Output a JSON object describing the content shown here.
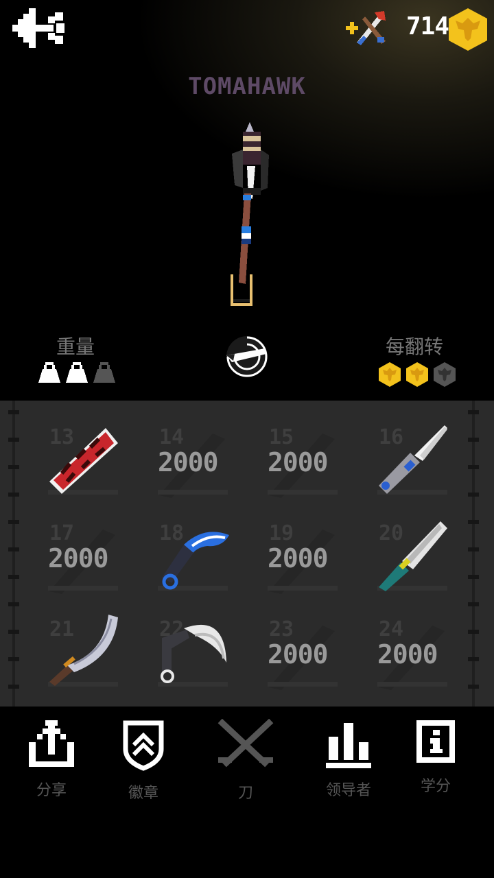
{
  "header": {
    "coins": "714"
  },
  "weapon": {
    "name": "TOMAHAWK"
  },
  "stats": {
    "weight_label": "重量",
    "weight_level": 2,
    "weight_max": 3,
    "flip_label": "每翻转",
    "flip_reward": 2,
    "flip_max": 3
  },
  "colors": {
    "coin": "#f3c21c",
    "locked_price": "#9a9a9a",
    "title": "#5e4a66",
    "panel": "#2b2b2b"
  },
  "grid": {
    "items": [
      {
        "num": "13",
        "price": "",
        "state": "unlocked",
        "icon": "red-wrap-knife"
      },
      {
        "num": "14",
        "price": "2000",
        "state": "locked"
      },
      {
        "num": "15",
        "price": "2000",
        "state": "locked"
      },
      {
        "num": "16",
        "price": "",
        "state": "unlocked",
        "icon": "butterfly-knife"
      },
      {
        "num": "17",
        "price": "2000",
        "state": "locked"
      },
      {
        "num": "18",
        "price": "",
        "state": "unlocked",
        "icon": "blue-karambit"
      },
      {
        "num": "19",
        "price": "2000",
        "state": "locked"
      },
      {
        "num": "20",
        "price": "",
        "state": "unlocked",
        "icon": "serrated-knife"
      },
      {
        "num": "21",
        "price": "",
        "state": "unlocked",
        "icon": "scimitar"
      },
      {
        "num": "22",
        "price": "",
        "state": "unlocked",
        "icon": "white-karambit"
      },
      {
        "num": "23",
        "price": "2000",
        "state": "locked"
      },
      {
        "num": "24",
        "price": "2000",
        "state": "locked"
      }
    ]
  },
  "nav": {
    "share": "分享",
    "badges": "徽章",
    "knives": "刀",
    "leaders": "领导者",
    "credits": "学分"
  }
}
